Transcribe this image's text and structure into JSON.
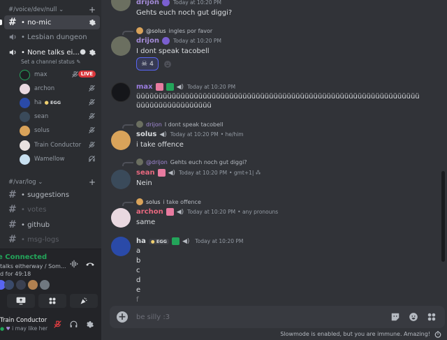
{
  "sidebar": {
    "category_voice": "#/voice/dev/null",
    "channels_voice": [
      {
        "name": "no-mic"
      },
      {
        "name": "Lesbian dungeon"
      },
      {
        "name": "None talks ei..."
      }
    ],
    "set_status": "Set a channel status",
    "voice_users": [
      {
        "name": "max",
        "live": "LIVE"
      },
      {
        "name": "archon"
      },
      {
        "name": "ha",
        "badge": "EGG"
      },
      {
        "name": "sean"
      },
      {
        "name": "solus"
      },
      {
        "name": "Train Conductor"
      },
      {
        "name": "Wamellow"
      }
    ],
    "category_log": "#/var/log",
    "channels_log": [
      {
        "name": "suggestions"
      },
      {
        "name": "votes"
      },
      {
        "name": "github"
      },
      {
        "name": "msg-logs"
      }
    ]
  },
  "voice_panel": {
    "status": "e Connected",
    "channel": "talks eitherway / Som...",
    "duration": "d for 49:18"
  },
  "user_panel": {
    "name": "Train Conductor",
    "status": "i may like her"
  },
  "messages": [
    {
      "user": "drijon",
      "time": "Today at 10:20 PM",
      "text": "Gehts euch noch gut diggi?"
    },
    {
      "reply_user": "@solus",
      "reply_text": "ingles por favor",
      "user": "drijon",
      "time": "Today at 10:20 PM",
      "text": "I dont speak tacobell",
      "reaction_count": "4"
    },
    {
      "user": "max",
      "time": "Today at 10:20 PM",
      "text": "üüüüüüüüüüüüüüüüüüüüüüüüüüüüüüüüüüüüüüüüüüüüüüüüüüüüüüüüüüüüüüüüüüüüüüüüüüüüüüüüü"
    },
    {
      "reply_user": "drijon",
      "reply_text": "I dont speak tacobell",
      "user": "solus",
      "time": "Today at 10:20 PM",
      "pronouns": "• he/him",
      "text": "i take offence"
    },
    {
      "reply_user": "@drijon",
      "reply_text": "Gehts euch noch gut diggi?",
      "user": "sean",
      "time": "Today at 10:20 PM",
      "pronouns": "• gmt+1| ⁂",
      "text": "Nein"
    },
    {
      "reply_user": "solus",
      "reply_text": "i take offence",
      "user": "archon",
      "time": "Today at 10:20 PM",
      "pronouns": "• any pronouns",
      "text": "same"
    },
    {
      "user": "ha",
      "badge": "EGG",
      "time": "Today at 10:20 PM",
      "lines": [
        "a",
        "b",
        "c",
        "d",
        "e",
        "f"
      ]
    }
  ],
  "composer": {
    "placeholder": "be silly :3"
  },
  "slowmode_text": "Slowmode is enabled, but you are immune. Amazing!",
  "colors": {
    "drijon": "#a48bd8",
    "max": "#9b7de0",
    "solus": "#dbdee1",
    "sean": "#e8687f",
    "archon": "#e8687f",
    "ha": "#dbdee1",
    "connected": "#23a55a",
    "live": "#da373c"
  }
}
